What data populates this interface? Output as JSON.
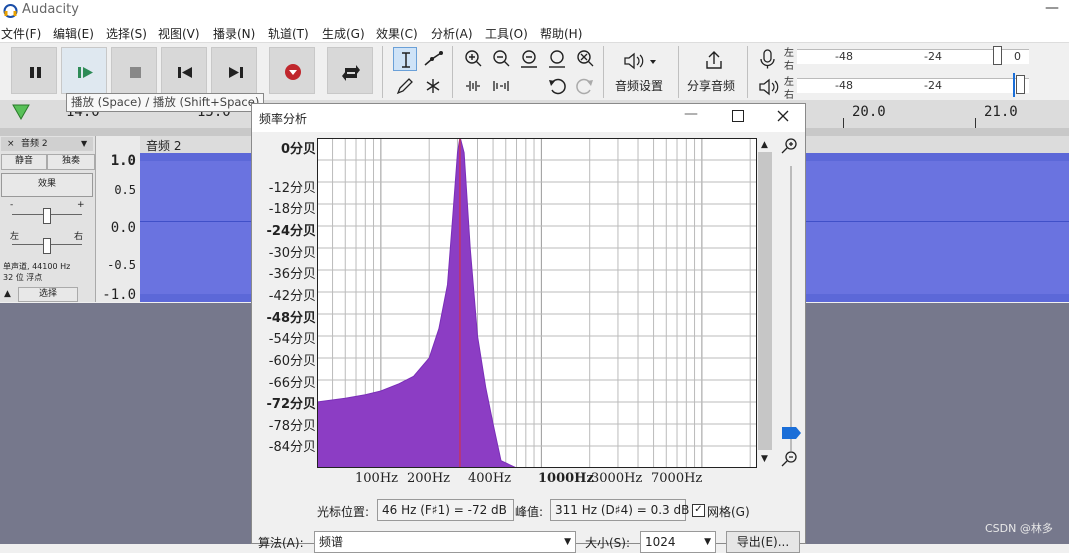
{
  "app": {
    "title": "Audacity"
  },
  "menu": [
    "文件(F)",
    "编辑(E)",
    "选择(S)",
    "视图(V)",
    "播录(N)",
    "轨道(T)",
    "生成(G)",
    "效果(C)",
    "分析(A)",
    "工具(O)",
    "帮助(H)"
  ],
  "toolbar": {
    "audio_setup_label": "音频设置",
    "share_label": "分享音频",
    "meter_left": "左",
    "meter_right": "右",
    "meter_ticks": [
      "-48",
      "-24",
      "0"
    ],
    "tooltip": "播放 (Space) / 播放 (Shift+Space)"
  },
  "timeline": {
    "labels": [
      "14.0",
      "15.0",
      "20.0",
      "21.0"
    ]
  },
  "track": {
    "name": "音频 2",
    "mute": "静音",
    "solo": "独奏",
    "effects": "效果",
    "gain_minus": "-",
    "gain_plus": "+",
    "pan_left": "左",
    "pan_right": "右",
    "info_line1": "单声道, 44100 Hz",
    "info_line2": "32 位 浮点",
    "select": "选择",
    "clip_name": "音频 2",
    "scale": [
      "1.0",
      "0.5",
      "0.0",
      "-0.5",
      "-1.0"
    ]
  },
  "dialog": {
    "title": "频率分析",
    "y_labels": [
      "0分贝",
      "-12分贝",
      "-18分贝",
      "-24分贝",
      "-30分贝",
      "-36分贝",
      "-42分贝",
      "-48分贝",
      "-54分贝",
      "-60分贝",
      "-66分贝",
      "-72分贝",
      "-78分贝",
      "-84分贝"
    ],
    "x_labels": [
      "100Hz",
      "200Hz",
      "400Hz",
      "1000Hz",
      "3000Hz",
      "7000Hz"
    ],
    "cursor_label": "光标位置:",
    "cursor_value": "46 Hz (F♯1) = -72 dB",
    "peak_label": "峰值:",
    "peak_value": "311 Hz (D♯4) = 0.3 dB",
    "grid_label": "网格(G)",
    "grid_checked": true,
    "algorithm_label": "算法(A):",
    "algorithm_value": "频谱",
    "size_label": "大小(S):",
    "size_value": "1024",
    "export_label": "导出(E)...",
    "spectrum_color": "#8c3dc4"
  },
  "chart_data": {
    "type": "area",
    "xlabel": "",
    "ylabel": "",
    "x_scale": "log",
    "xlim": [
      40,
      22050
    ],
    "ylim": [
      -90,
      0
    ],
    "x": [
      40,
      60,
      80,
      100,
      130,
      160,
      200,
      230,
      260,
      280,
      300,
      311,
      330,
      360,
      400,
      450,
      500,
      560,
      700,
      1000
    ],
    "values": [
      -72,
      -71,
      -70,
      -69,
      -67,
      -65,
      -60,
      -52,
      -40,
      -22,
      -4,
      0.3,
      -4,
      -30,
      -54,
      -68,
      -78,
      -88,
      -90,
      -90
    ],
    "peak": {
      "x": 311,
      "y": 0.3
    }
  },
  "watermark": "CSDN @林多"
}
